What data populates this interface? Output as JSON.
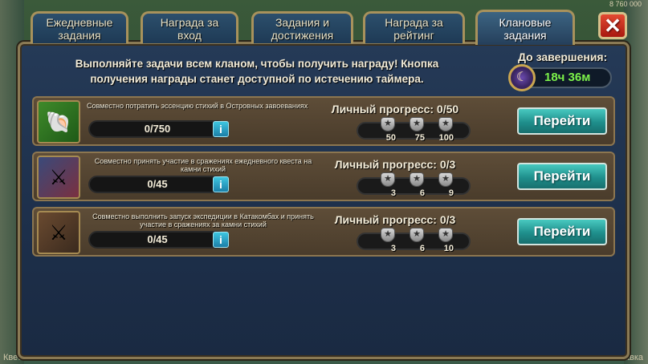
{
  "background": {
    "top_number": "8 760 000",
    "bottom_left": "Квесты",
    "bottom_right": "Лавка"
  },
  "tabs": [
    {
      "label": "Ежедневные задания",
      "active": false
    },
    {
      "label": "Награда за вход",
      "active": false
    },
    {
      "label": "Задания и достижения",
      "active": false
    },
    {
      "label": "Награда за рейтинг",
      "active": false
    },
    {
      "label": "Клановые задания",
      "active": true
    }
  ],
  "close_label": "✕",
  "description": "Выполняйте задачи всем кланом, чтобы получить награду! Кнопка получения награды станет доступной по истечению таймера.",
  "timer": {
    "label": "До завершения:",
    "value": "18ч 36м"
  },
  "quests": [
    {
      "icon": "elemental-essence-icon",
      "text": "Совместно потратить эссенцию стихий в Островных завоеваниях",
      "bar_value": "0/750",
      "progress_fraction": 0,
      "info_label": "i",
      "personal_progress": "Личный прогресс: 0/50",
      "milestones": [
        "50",
        "75",
        "100"
      ],
      "button_label": "Перейти"
    },
    {
      "icon": "elemental-stones-icon",
      "text": "Совместно принять участие в сражениях ежедневного квеста на камни стихий",
      "bar_value": "0/45",
      "progress_fraction": 0,
      "info_label": "i",
      "personal_progress": "Личный прогресс: 0/3",
      "milestones": [
        "3",
        "6",
        "9"
      ],
      "button_label": "Перейти"
    },
    {
      "icon": "catacombs-expedition-icon",
      "text": "Совместно выполнить запуск экспедиции в Катакомбах и принять участие в сражениях за камни стихий",
      "bar_value": "0/45",
      "progress_fraction": 0,
      "info_label": "i",
      "personal_progress": "Личный прогресс: 0/3",
      "milestones": [
        "3",
        "6",
        "10"
      ],
      "button_label": "Перейти"
    }
  ]
}
